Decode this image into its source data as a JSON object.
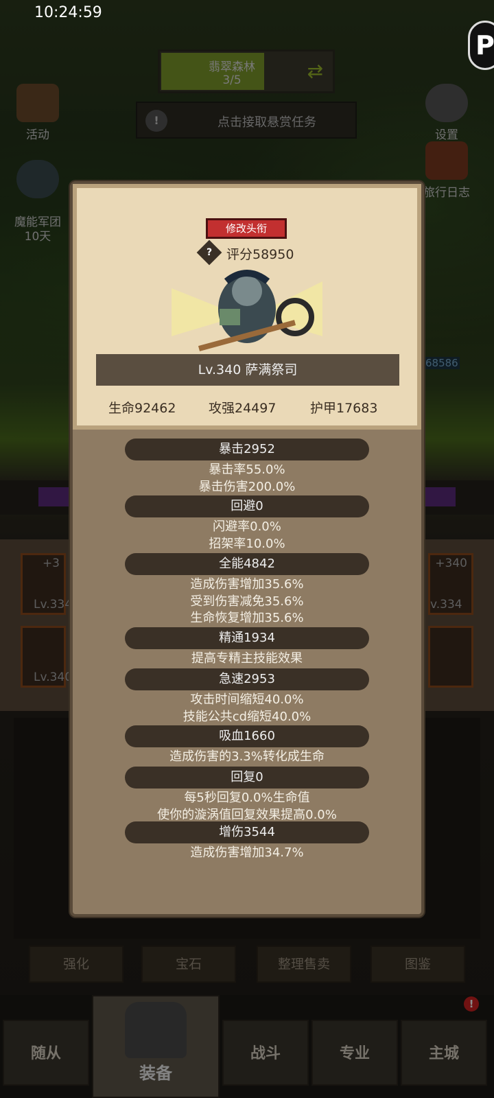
{
  "status_bar": {
    "time": "10:24:59"
  },
  "region": {
    "name": "翡翠森林",
    "progress": "3/5",
    "progress_fraction": 0.6
  },
  "bounty": {
    "label": "点击接取悬赏任务"
  },
  "side_left": [
    {
      "label": "活动"
    },
    {
      "label": "魔能军团\n10天"
    }
  ],
  "side_right": [
    {
      "label": "设置"
    },
    {
      "label": "旅行日志"
    }
  ],
  "enemy_hp": "68586",
  "profile": {
    "title_button": "修改头衔",
    "score_label": "评分58950",
    "hero_name": "Lv.340 萨满祭司",
    "basic_stats": [
      "生命92462",
      "攻强24497",
      "护甲17683"
    ]
  },
  "stats": [
    {
      "header": "暴击2952",
      "lines": [
        "暴击率55.0%",
        "暴击伤害200.0%"
      ]
    },
    {
      "header": "回避0",
      "lines": [
        "闪避率0.0%",
        "招架率10.0%"
      ]
    },
    {
      "header": "全能4842",
      "lines": [
        "造成伤害增加35.6%",
        "受到伤害减免35.6%",
        "生命恢复增加35.6%"
      ]
    },
    {
      "header": "精通1934",
      "lines": [
        "提高专精主技能效果"
      ]
    },
    {
      "header": "急速2953",
      "lines": [
        "攻击时间缩短40.0%",
        "技能公共cd缩短40.0%"
      ]
    },
    {
      "header": "吸血1660",
      "lines": [
        "造成伤害的3.3%转化成生命"
      ]
    },
    {
      "header": "回复0",
      "lines": [
        "每5秒回复0.0%生命值",
        "使你的漩涡值回复效果提高0.0%"
      ]
    },
    {
      "header": "增伤3544",
      "lines": [
        "造成伤害增加34.7%"
      ]
    }
  ],
  "equip_slots": {
    "left_top": [
      "+3",
      "Lv.334"
    ],
    "left_bottom": "Lv.340",
    "right_top": [
      "+340",
      "v.334"
    ]
  },
  "action_buttons": [
    "强化",
    "宝石",
    "整理售卖",
    "图鉴"
  ],
  "nav": [
    "随从",
    "装备",
    "战斗",
    "专业",
    "主城"
  ],
  "nav_badge": "!"
}
